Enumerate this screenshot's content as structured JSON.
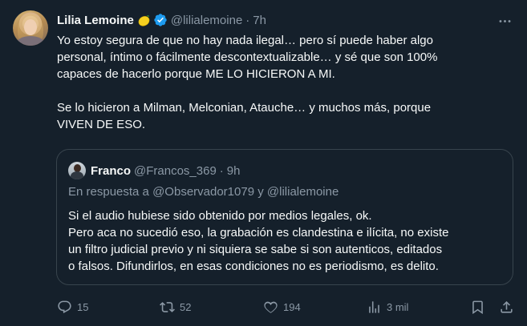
{
  "author": {
    "name": "Lilia Lemoine",
    "handle": "@lilialemoine",
    "time": "7h",
    "separator": "·"
  },
  "tweet": {
    "paragraphs": [
      "Yo estoy segura de que no hay nada ilegal… pero sí puede haber algo\npersonal, íntimo o fácilmente descontextualizable… y sé que son 100%\ncapaces de hacerlo porque ME LO HICIERON A MI.",
      "Se lo hicieron a Milman, Melconian, Atauche… y muchos más, porque\nVIVEN DE ESO."
    ]
  },
  "quote": {
    "name": "Franco",
    "handle": "@Francos_369",
    "time": "9h",
    "separator": "·",
    "reply_prefix": "En respuesta a ",
    "reply_to_1": "@Observador1079",
    "reply_and": " y ",
    "reply_to_2": "@lilialemoine",
    "text": "Si el audio hubiese sido obtenido por medios legales, ok.\nPero aca no sucedió eso, la grabación es clandestina e ilícita, no existe\nun filtro judicial previo y ni siquiera se sabe si son autenticos, editados\no falsos. Difundirlos, en esas condiciones no es periodismo, es delito."
  },
  "actions": {
    "replies": "15",
    "retweets": "52",
    "likes": "194",
    "views": "3 mil"
  },
  "icons": {
    "verified": "verified-badge-icon",
    "emoji": "lemon-emoji",
    "more": "more-icon",
    "reply": "reply-icon",
    "retweet": "retweet-icon",
    "like": "heart-icon",
    "views": "views-icon",
    "bookmark": "bookmark-icon",
    "share": "share-icon"
  },
  "colors": {
    "background": "#15202b",
    "text": "#f7f9f9",
    "secondary": "#8b98a5",
    "verified": "#1d9bf0",
    "border": "#38444d"
  }
}
